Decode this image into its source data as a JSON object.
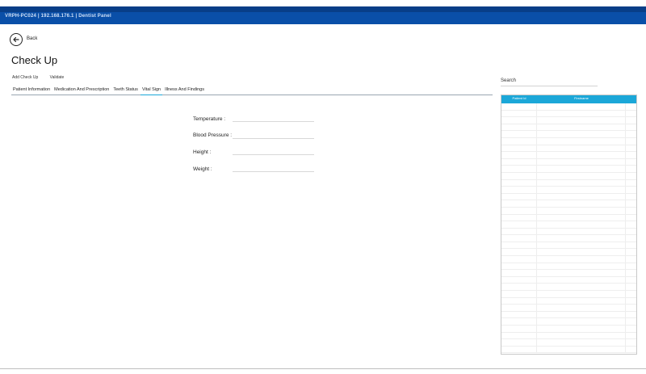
{
  "window": {
    "title": "VRPH-PC024 | 192.168.176.1 | Dentist Panel"
  },
  "nav": {
    "back_label": "Back"
  },
  "page": {
    "title": "Check Up"
  },
  "actions": {
    "add_checkup": "Add Check Up",
    "validate": "Validate"
  },
  "tabs": [
    {
      "label": "Patient Information"
    },
    {
      "label": "Medication And Prescription"
    },
    {
      "label": "Teeth Status"
    },
    {
      "label": "Vital Sign",
      "active": true
    },
    {
      "label": "Illness And Findings"
    }
  ],
  "vitals": {
    "temperature_label": "Temperature :",
    "temperature_value": "",
    "blood_pressure_label": "Blood Pressure :",
    "blood_pressure_value": "",
    "height_label": "Height :",
    "height_value": "",
    "weight_label": "Weight :",
    "weight_value": ""
  },
  "search": {
    "label": "Search",
    "value": ""
  },
  "patient_table": {
    "columns": [
      "Patient Id",
      "Firstname"
    ],
    "rows": []
  },
  "colors": {
    "title_bar": "#0a4fa8",
    "accent": "#1ba7d8"
  }
}
